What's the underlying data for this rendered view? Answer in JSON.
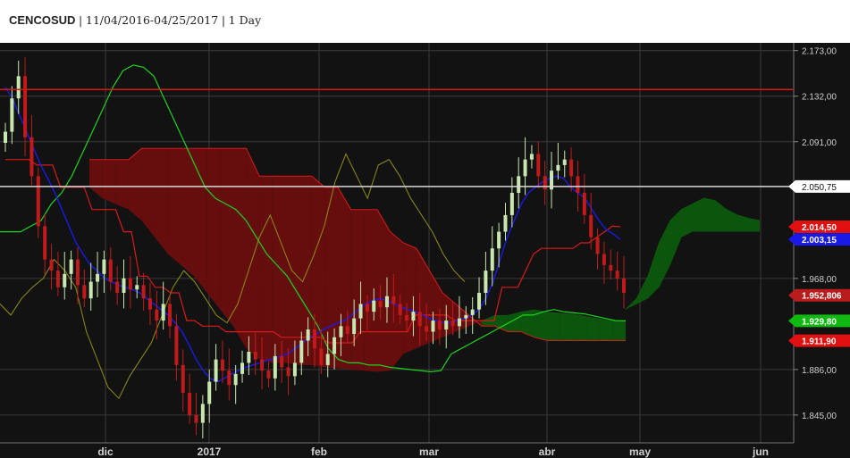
{
  "header": {
    "symbol": "CENCOSUD",
    "separator": "|",
    "date_range": "11/04/2016-04/25/2017",
    "interval": "1 Day"
  },
  "colors": {
    "background": "#121212",
    "grid": "#3a3a3a",
    "up": "#c8e6b0",
    "down": "#c21a1a",
    "tenkan": "#1a1ae6",
    "kijun": "#d81b1b",
    "senkou_a": "#1ed31e",
    "chikou": "#8f8f14",
    "cloud_bull": "#0d5a0d",
    "cloud_bear": "#6b0e0e",
    "hline_red": "#d21a1a",
    "hline_white": "#d8d8d8"
  },
  "chart_data": {
    "type": "candlestick-ichimoku",
    "title": "CENCOSUD",
    "interval": "1 Day",
    "ylim": [
      1820,
      2180
    ],
    "x_axis_labels": [
      "dic",
      "2017",
      "feb",
      "mar",
      "abr",
      "may",
      "jun"
    ],
    "y_tick_labels": [
      "2.173,00",
      "2.132,00",
      "2.091,00",
      "2.050,75",
      "1.968,00",
      "1.886,00",
      "1.845,00"
    ],
    "y_tick_values": [
      2173,
      2132,
      2091,
      2050.75,
      1968,
      1886,
      1845
    ],
    "horizontal_lines": [
      {
        "value": 2138,
        "color": "red"
      },
      {
        "value": 2050.75,
        "color": "white"
      }
    ],
    "badges": [
      {
        "label": "2.050,75",
        "value": 2050.75,
        "bg": "#ffffff",
        "fg": "#111111"
      },
      {
        "label": "2.014,50",
        "value": 2014.5,
        "bg": "#e01010",
        "fg": "#ffffff"
      },
      {
        "label": "2.003,15",
        "value": 2003.15,
        "bg": "#1a1ae6",
        "fg": "#ffffff"
      },
      {
        "label": "1.952,806",
        "value": 1952.8,
        "bg": "#b91c1c",
        "fg": "#ffffff"
      },
      {
        "label": "1.929,80",
        "value": 1929.8,
        "bg": "#12b812",
        "fg": "#ffffff"
      },
      {
        "label": "1.911,90",
        "value": 1911.9,
        "bg": "#e01010",
        "fg": "#ffffff"
      }
    ],
    "candles_close": [
      2100,
      2130,
      2150,
      2095,
      2060,
      2015,
      1985,
      1975,
      1960,
      1972,
      1985,
      1962,
      1950,
      1965,
      1972,
      1985,
      1965,
      1955,
      1968,
      1958,
      1962,
      1950,
      1940,
      1930,
      1945,
      1925,
      1890,
      1865,
      1845,
      1838,
      1855,
      1875,
      1895,
      1885,
      1872,
      1882,
      1892,
      1902,
      1895,
      1885,
      1878,
      1898,
      1888,
      1880,
      1892,
      1912,
      1922,
      1905,
      1890,
      1900,
      1915,
      1925,
      1918,
      1932,
      1945,
      1938,
      1948,
      1942,
      1952,
      1945,
      1935,
      1930,
      1938,
      1925,
      1920,
      1930,
      1922,
      1930,
      1925,
      1932,
      1935,
      1940,
      1955,
      1975,
      1995,
      2010,
      2025,
      2045,
      2060,
      2075,
      2080,
      2060,
      2048,
      2065,
      2070,
      2075,
      2060,
      2045,
      2025,
      2005,
      1990,
      1980,
      1975,
      1968,
      1955
    ],
    "tenkan": [
      2140,
      2130,
      2115,
      2100,
      2085,
      2070,
      2058,
      2045,
      2030,
      2015,
      2000,
      1990,
      1980,
      1975,
      1968,
      1965,
      1962,
      1960,
      1958,
      1955,
      1950,
      1945,
      1940,
      1935,
      1928,
      1920,
      1908,
      1895,
      1885,
      1878,
      1875,
      1878,
      1882,
      1885,
      1888,
      1890,
      1892,
      1894,
      1896,
      1898,
      1900,
      1905,
      1910,
      1915,
      1918,
      1922,
      1925,
      1928,
      1930,
      1935,
      1940,
      1945,
      1948,
      1950,
      1948,
      1945,
      1942,
      1940,
      1938,
      1935,
      1932,
      1930,
      1928,
      1928,
      1930,
      1932,
      1935,
      1940,
      1950,
      1965,
      1985,
      2005,
      2020,
      2035,
      2045,
      2050,
      2055,
      2058,
      2060,
      2058,
      2050,
      2045,
      2040,
      2030,
      2020,
      2012,
      2008,
      2003
    ],
    "kijun": [
      2075,
      2075,
      2075,
      2075,
      2070,
      2070,
      2070,
      2050,
      2050,
      2050,
      2050,
      2030,
      2030,
      2030,
      2030,
      2010,
      2010,
      1970,
      1970,
      1960,
      1960,
      1955,
      1955,
      1930,
      1930,
      1925,
      1925,
      1925,
      1920,
      1920,
      1920,
      1920,
      1920,
      1920,
      1920,
      1915,
      1915,
      1915,
      1915,
      1915,
      1915,
      1910,
      1910,
      1910,
      1910,
      1920,
      1920,
      1920,
      1920,
      1920,
      1920,
      1920,
      1935,
      1935,
      1935,
      1935,
      1935,
      1930,
      1930,
      1930,
      1930,
      1930,
      1930,
      1960,
      1960,
      1960,
      1975,
      1990,
      1995,
      1995,
      1995,
      1995,
      1995,
      2000,
      2000,
      2005,
      2010,
      2015,
      2014.5
    ],
    "senkou_a": [
      2010,
      2010,
      2010,
      2015,
      2020,
      2035,
      2045,
      2060,
      2080,
      2100,
      2120,
      2140,
      2155,
      2160,
      2158,
      2150,
      2130,
      2110,
      2090,
      2070,
      2050,
      2040,
      2035,
      2030,
      2020,
      2005,
      1990,
      1980,
      1970,
      1955,
      1940,
      1925,
      1905,
      1895,
      1892,
      1892,
      1890,
      1890,
      1888,
      1887,
      1886,
      1885,
      1884,
      1885,
      1900,
      1905,
      1910,
      1915,
      1920,
      1925,
      1930,
      1935,
      1935,
      1938,
      1940,
      1938,
      1937,
      1936,
      1934,
      1932,
      1930,
      1929.8
    ],
    "senkou_b": [
      2075,
      2075,
      2075,
      2075,
      2085,
      2085,
      2085,
      2085,
      2085,
      2085,
      2085,
      2085,
      2085,
      2060,
      2060,
      2060,
      2060,
      2060,
      2050,
      2050,
      2030,
      2030,
      2030,
      2010,
      2000,
      1995,
      1975,
      1955,
      1945,
      1935,
      1925,
      1925,
      1920,
      1920,
      1915,
      1912,
      1912,
      1912,
      1912,
      1912,
      1912,
      1911.9
    ],
    "cloud_future_a": [
      1940,
      1950,
      1970,
      2000,
      2020,
      2030,
      2035,
      2040,
      2038,
      2030,
      2025,
      2022,
      2020
    ],
    "cloud_future_b": [
      1940,
      1945,
      1950,
      1960,
      1980,
      2005,
      2010,
      2010,
      2010,
      2010,
      2010,
      2010,
      2010
    ],
    "chikou": [
      1945,
      1935,
      1950,
      1960,
      1968,
      1985,
      1975,
      1960,
      1920,
      1895,
      1870,
      1860,
      1880,
      1895,
      1910,
      1935,
      1960,
      1975,
      1965,
      1950,
      1935,
      1928,
      1945,
      1975,
      2005,
      2025,
      2000,
      1975,
      1965,
      1988,
      2015,
      2055,
      2080,
      2060,
      2040,
      2070,
      2075,
      2060,
      2040,
      2025,
      2010,
      1990,
      1975,
      1965
    ]
  }
}
